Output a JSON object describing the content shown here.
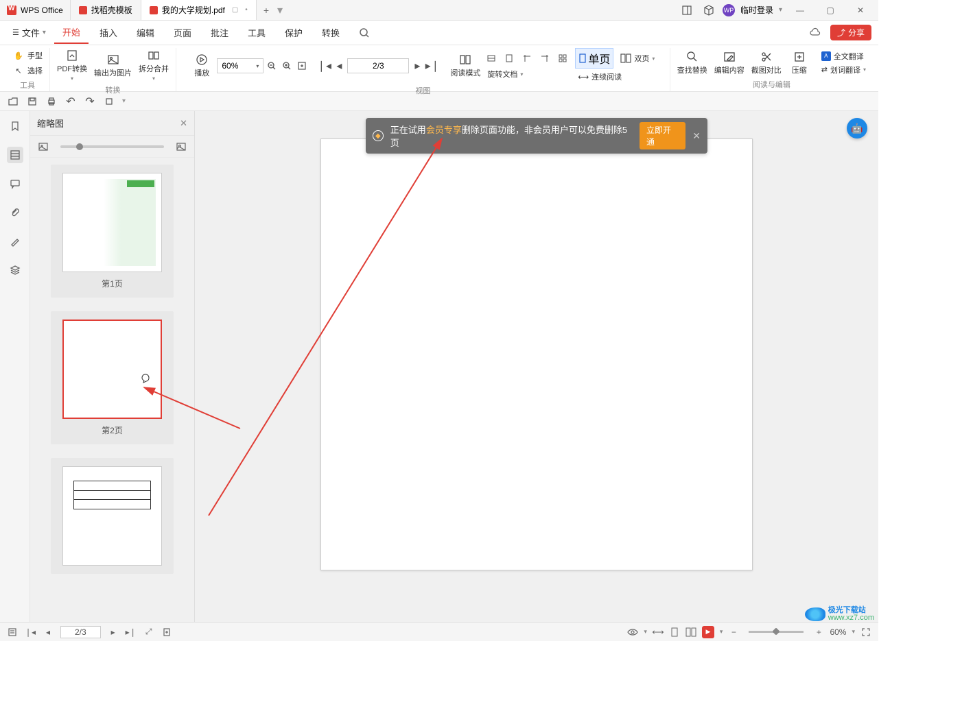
{
  "app_title": "WPS Office",
  "tabs": [
    {
      "label": "找稻壳模板"
    },
    {
      "label": "我的大学规划.pdf"
    }
  ],
  "login_label": "临时登录",
  "file_menu": "文件",
  "menus": [
    "开始",
    "插入",
    "编辑",
    "页面",
    "批注",
    "工具",
    "保护",
    "转换"
  ],
  "active_menu": "开始",
  "share_label": "分享",
  "ribbon": {
    "tool_group": "工具",
    "hand": "手型",
    "select": "选择",
    "convert_group": "转换",
    "pdf_convert": "PDF转换",
    "export_img": "输出为图片",
    "split_merge": "拆分合并",
    "play": "播放",
    "zoom_value": "60%",
    "page_value": "2/3",
    "rotate_doc": "旋转文档",
    "single_page": "单页",
    "double_page": "双页",
    "continuous": "连续阅读",
    "reading_mode": "阅读模式",
    "view_group": "视图",
    "find_replace": "查找替换",
    "edit_content": "编辑内容",
    "screenshot_compare": "截图对比",
    "compress": "压缩",
    "full_translate": "全文翻译",
    "word_translate": "划词翻译",
    "edit_read_group": "阅读与编辑"
  },
  "thumb": {
    "title": "缩略图",
    "page1": "第1页",
    "page2": "第2页"
  },
  "banner": {
    "text_before": "正在试用",
    "vip_text": "会员专享",
    "text_after": "删除页面功能，非会员用户可以免费删除5页",
    "button": "立即开通"
  },
  "status": {
    "page": "2/3",
    "zoom": "60%"
  },
  "watermark": {
    "site": "极光下载站",
    "url": "www.xz7.com"
  }
}
